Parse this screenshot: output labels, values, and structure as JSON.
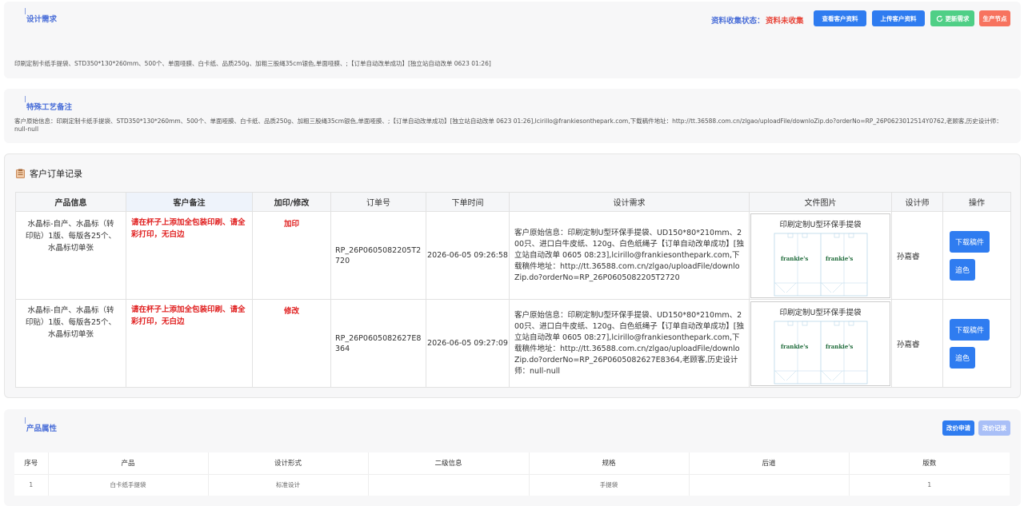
{
  "design_req": {
    "title": "设计需求",
    "status_label": "资料收集状态：",
    "status_value": "资料未收集",
    "btn_view": "查看客户资料",
    "btn_upload": "上传客户资料",
    "btn_update": "更新需求",
    "btn_node": "生产节点",
    "text": "印刷定制卡纸手提袋、STD350*130*260mm、500个、单面哑膜、白卡纸、品质250g、加粗三股绳35cm银色,单面哑膜、;【订单自动改单成功】[独立站自动改单 0623 01:26]"
  },
  "craft": {
    "title": "特殊工艺备注",
    "text": "客户原始信息：印刷定制卡纸手提袋、STD350*130*260mm、500个、单面哑膜、白卡纸、品质250g、加粗三股绳35cm银色,单面哑膜、;【订单自动改单成功】[独立站自动改单 0623 01:26],lcirillo@frankiesonthepark.com,下载稿件地址：http://tt.36588.com.cn/zlgao/uploadFile/downloZip.do?orderNo=RP_26P0623012514Y0762,老顾客,历史设计师：null-null"
  },
  "orders": {
    "title": "客户订单记录",
    "headers": [
      "产品信息",
      "客户备注",
      "加印/修改",
      "订单号",
      "下单时间",
      "设计需求",
      "文件图片",
      "设计师",
      "操作"
    ],
    "rows": [
      {
        "product": "水晶标-自产、水晶标（转印贴）1版、每版各25个、水晶标切单张",
        "remark": "请在杯子上添加全包装印刷、请全彩打印，无白边",
        "type": "加印",
        "order_no": "RP_26P0605082205T2720",
        "time": "2026-06-05 09:26:58",
        "design": "客户原始信息：印刷定制U型环保手提袋、UD150*80*210mm、200只、进口白牛皮纸、120g、白色纸绳子【订单自动改单成功】[独立站自动改单 0605 08:23],lcirillo@frankiesonthepark.com,下载稿件地址：http://tt.36588.com.cn/zlgao/uploadFile/downloZip.do?orderNo=RP_26P0605082205T2720",
        "image_title": "印刷定制U型环保手提袋",
        "logo": "frankie's",
        "designer": "孙嘉睿",
        "btn_download": "下载稿件",
        "btn_color": "追色"
      },
      {
        "product": "水晶标-自产、水晶标（转印贴）1版、每版各25个、水晶标切单张",
        "remark": "请在杯子上添加全包装印刷、请全彩打印，无白边",
        "type": "修改",
        "order_no": "RP_26P0605082627E8364",
        "time": "2026-06-05 09:27:09",
        "design": "客户原始信息：印刷定制U型环保手提袋、UD150*80*210mm、200只、进口白牛皮纸、120g、白色纸绳子【订单自动改单成功】[独立站自动改单 0605 08:27],lcirillo@frankiesonthepark.com,下载稿件地址：http://tt.36588.com.cn/zlgao/uploadFile/downloZip.do?orderNo=RP_26P0605082627E8364,老顾客,历史设计师：null-null",
        "image_title": "印刷定制U型环保手提袋",
        "logo": "frankie's",
        "designer": "孙嘉睿",
        "btn_download": "下载稿件",
        "btn_color": "追色"
      }
    ]
  },
  "attrs": {
    "title": "产品属性",
    "btn_change": "改价申请",
    "btn_record": "改价记录",
    "headers": [
      "序号",
      "产品",
      "设计形式",
      "二级信息",
      "规格",
      "后道",
      "版数"
    ],
    "row": [
      "1",
      "白卡纸手提袋",
      "标准设计",
      "",
      "手提袋",
      "",
      "1"
    ]
  }
}
